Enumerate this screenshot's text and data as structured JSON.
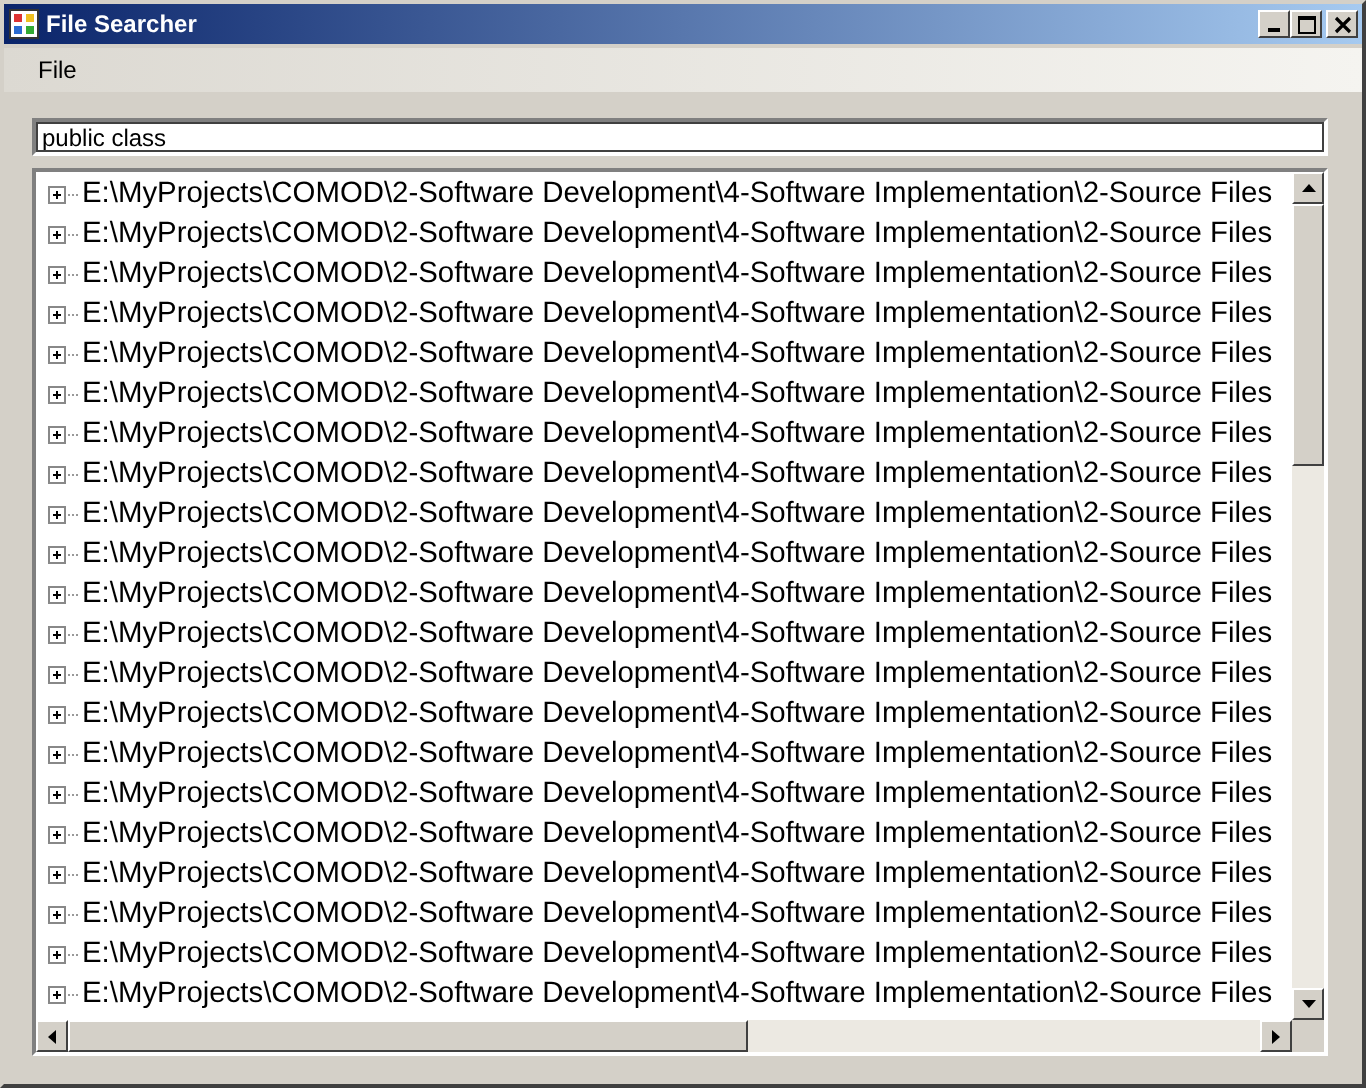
{
  "window": {
    "title": "File Searcher"
  },
  "menu": [
    "File"
  ],
  "search": {
    "value": "public class"
  },
  "tree": {
    "items": [
      {
        "label": "E:\\MyProjects\\COMOD\\2-Software Development\\4-Software Implementation\\2-Source Files",
        "expanded": false
      },
      {
        "label": "E:\\MyProjects\\COMOD\\2-Software Development\\4-Software Implementation\\2-Source Files",
        "expanded": false
      },
      {
        "label": "E:\\MyProjects\\COMOD\\2-Software Development\\4-Software Implementation\\2-Source Files",
        "expanded": false
      },
      {
        "label": "E:\\MyProjects\\COMOD\\2-Software Development\\4-Software Implementation\\2-Source Files",
        "expanded": false
      },
      {
        "label": "E:\\MyProjects\\COMOD\\2-Software Development\\4-Software Implementation\\2-Source Files",
        "expanded": false
      },
      {
        "label": "E:\\MyProjects\\COMOD\\2-Software Development\\4-Software Implementation\\2-Source Files",
        "expanded": false
      },
      {
        "label": "E:\\MyProjects\\COMOD\\2-Software Development\\4-Software Implementation\\2-Source Files",
        "expanded": false
      },
      {
        "label": "E:\\MyProjects\\COMOD\\2-Software Development\\4-Software Implementation\\2-Source Files",
        "expanded": false
      },
      {
        "label": "E:\\MyProjects\\COMOD\\2-Software Development\\4-Software Implementation\\2-Source Files",
        "expanded": false
      },
      {
        "label": "E:\\MyProjects\\COMOD\\2-Software Development\\4-Software Implementation\\2-Source Files",
        "expanded": false
      },
      {
        "label": "E:\\MyProjects\\COMOD\\2-Software Development\\4-Software Implementation\\2-Source Files",
        "expanded": false
      },
      {
        "label": "E:\\MyProjects\\COMOD\\2-Software Development\\4-Software Implementation\\2-Source Files",
        "expanded": false
      },
      {
        "label": "E:\\MyProjects\\COMOD\\2-Software Development\\4-Software Implementation\\2-Source Files",
        "expanded": false
      },
      {
        "label": "E:\\MyProjects\\COMOD\\2-Software Development\\4-Software Implementation\\2-Source Files",
        "expanded": false
      },
      {
        "label": "E:\\MyProjects\\COMOD\\2-Software Development\\4-Software Implementation\\2-Source Files",
        "expanded": false
      },
      {
        "label": "E:\\MyProjects\\COMOD\\2-Software Development\\4-Software Implementation\\2-Source Files",
        "expanded": false
      },
      {
        "label": "E:\\MyProjects\\COMOD\\2-Software Development\\4-Software Implementation\\2-Source Files",
        "expanded": false
      },
      {
        "label": "E:\\MyProjects\\COMOD\\2-Software Development\\4-Software Implementation\\2-Source Files",
        "expanded": false
      },
      {
        "label": "E:\\MyProjects\\COMOD\\2-Software Development\\4-Software Implementation\\2-Source Files",
        "expanded": false
      },
      {
        "label": "E:\\MyProjects\\COMOD\\2-Software Development\\4-Software Implementation\\2-Source Files",
        "expanded": false
      },
      {
        "label": "E:\\MyProjects\\COMOD\\2-Software Development\\4-Software Implementation\\2-Source Files",
        "expanded": false
      }
    ]
  }
}
